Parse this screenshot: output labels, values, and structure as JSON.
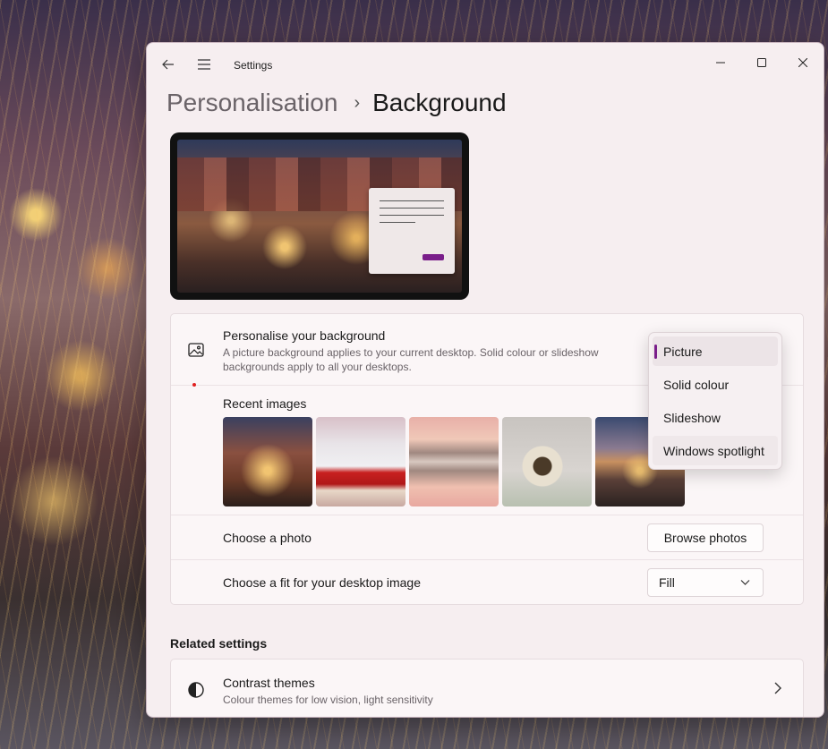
{
  "window": {
    "title": "Settings",
    "controls": {
      "minimize": "—",
      "maximize": "☐",
      "close": "✕"
    }
  },
  "breadcrumb": {
    "parent": "Personalisation",
    "separator": "›",
    "current": "Background"
  },
  "personalise": {
    "title": "Personalise your background",
    "description": "A picture background applies to your current desktop. Solid colour or slideshow backgrounds apply to all your desktops.",
    "icon": "picture-icon",
    "options": [
      "Picture",
      "Solid colour",
      "Slideshow",
      "Windows spotlight"
    ],
    "selected": "Picture"
  },
  "recent": {
    "label": "Recent images",
    "images": [
      "christmas-market",
      "red-cabins-snow",
      "mountain-lake-reflection",
      "owl-on-branch",
      "city-night"
    ]
  },
  "choose_photo": {
    "label": "Choose a photo",
    "button": "Browse photos"
  },
  "fit": {
    "label": "Choose a fit for your desktop image",
    "value": "Fill"
  },
  "related": {
    "heading": "Related settings",
    "contrast": {
      "title": "Contrast themes",
      "description": "Colour themes for low vision, light sensitivity"
    }
  },
  "colors": {
    "accent": "#7a1e8a",
    "window_bg": "#f6eef0",
    "card_bg": "#fbf6f7"
  }
}
